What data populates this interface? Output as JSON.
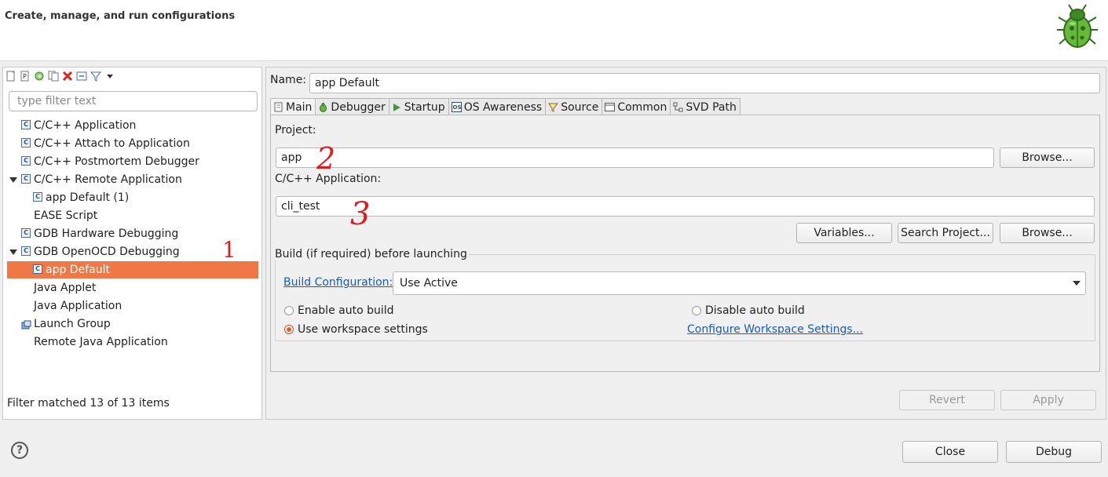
{
  "header": {
    "title": "Create, manage, and run configurations"
  },
  "left": {
    "filter_placeholder": "type filter text",
    "tree": [
      {
        "label": "C/C++ Application"
      },
      {
        "label": "C/C++ Attach to Application"
      },
      {
        "label": "C/C++ Postmortem Debugger"
      },
      {
        "label": "C/C++ Remote Application",
        "expanded": true
      },
      {
        "label": "app Default (1)",
        "child": true
      },
      {
        "label": "EASE Script"
      },
      {
        "label": "GDB Hardware Debugging"
      },
      {
        "label": "GDB OpenOCD Debugging",
        "expanded": true
      },
      {
        "label": "app Default",
        "child": true,
        "selected": true
      },
      {
        "label": "Java Applet"
      },
      {
        "label": "Java Application"
      },
      {
        "label": "Launch Group"
      },
      {
        "label": "Remote Java Application"
      }
    ],
    "filter_status": "Filter matched 13 of 13 items"
  },
  "right": {
    "name_label": "Name:",
    "name_value": "app Default",
    "tabs": [
      {
        "label": "Main",
        "icon": "document-icon",
        "active": true
      },
      {
        "label": "Debugger",
        "icon": "bug-icon"
      },
      {
        "label": "Startup",
        "icon": "play-icon"
      },
      {
        "label": "OS Awareness",
        "icon": "os-icon"
      },
      {
        "label": "Source",
        "icon": "source-icon"
      },
      {
        "label": "Common",
        "icon": "common-icon"
      },
      {
        "label": "SVD Path",
        "icon": "svd-icon"
      }
    ],
    "project_label": "Project:",
    "project_value": "app",
    "browse_label": "Browse...",
    "app_label": "C/C++ Application:",
    "app_value": "cli_test",
    "variables_label": "Variables...",
    "search_project_label": "Search Project...",
    "browse2_label": "Browse...",
    "build_group_label": "Build (if required) before launching",
    "build_config_label": "Build Configuration:",
    "build_config_value": "Use Active",
    "enable_auto_build": "Enable auto build",
    "disable_auto_build": "Disable auto build",
    "use_workspace_settings": "Use workspace settings",
    "configure_workspace_settings": "Configure Workspace Settings...",
    "revert_label": "Revert",
    "apply_label": "Apply"
  },
  "annotations": {
    "one": "1",
    "two": "2",
    "three": "3"
  },
  "footer": {
    "close_label": "Close",
    "debug_label": "Debug"
  },
  "colors": {
    "selection": "#f07746",
    "link": "#1a5bb5",
    "annotation": "#e01c1c"
  }
}
